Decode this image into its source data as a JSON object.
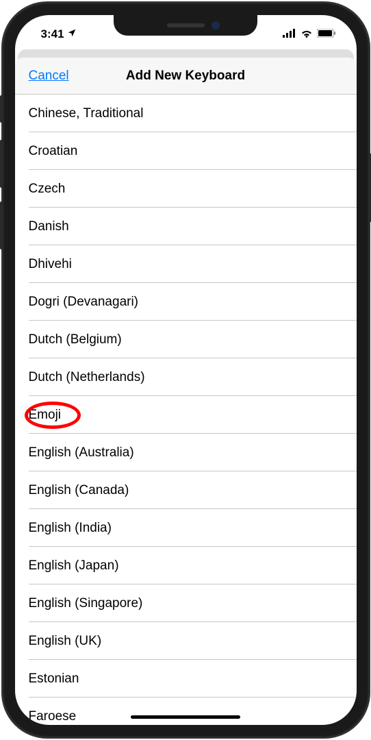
{
  "status": {
    "time": "3:41",
    "location": "➤"
  },
  "nav": {
    "cancel": "Cancel",
    "title": "Add New Keyboard"
  },
  "keyboards": [
    {
      "label": "Chinese, Traditional",
      "highlighted": false
    },
    {
      "label": "Croatian",
      "highlighted": false
    },
    {
      "label": "Czech",
      "highlighted": false
    },
    {
      "label": "Danish",
      "highlighted": false
    },
    {
      "label": "Dhivehi",
      "highlighted": false
    },
    {
      "label": "Dogri (Devanagari)",
      "highlighted": false
    },
    {
      "label": "Dutch (Belgium)",
      "highlighted": false
    },
    {
      "label": "Dutch (Netherlands)",
      "highlighted": false
    },
    {
      "label": "Emoji",
      "highlighted": true
    },
    {
      "label": "English (Australia)",
      "highlighted": false
    },
    {
      "label": "English (Canada)",
      "highlighted": false
    },
    {
      "label": "English (India)",
      "highlighted": false
    },
    {
      "label": "English (Japan)",
      "highlighted": false
    },
    {
      "label": "English (Singapore)",
      "highlighted": false
    },
    {
      "label": "English (UK)",
      "highlighted": false
    },
    {
      "label": "Estonian",
      "highlighted": false
    },
    {
      "label": "Faroese",
      "highlighted": false
    }
  ]
}
